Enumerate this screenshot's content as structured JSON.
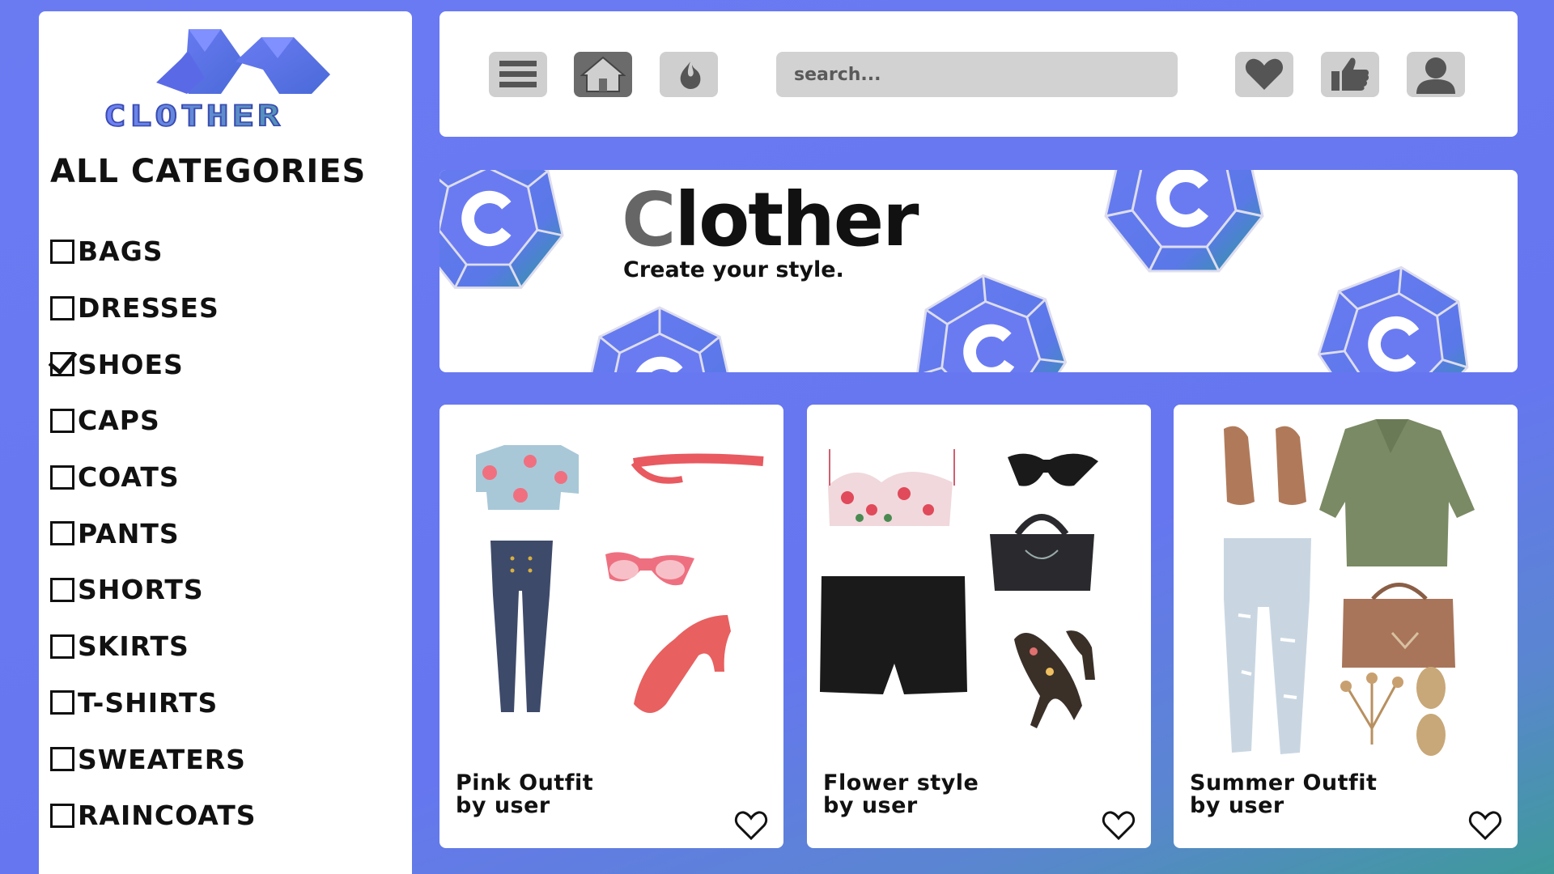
{
  "brand": {
    "logo_text": "CLOTHER",
    "banner_title": "Clother",
    "banner_tagline": "Create your style."
  },
  "sidebar": {
    "title": "ALL CATEGORIES",
    "categories": [
      {
        "label": "BAGS",
        "checked": false
      },
      {
        "label": "DRESSES",
        "checked": false
      },
      {
        "label": "SHOES",
        "checked": true
      },
      {
        "label": "CAPS",
        "checked": false
      },
      {
        "label": "COATS",
        "checked": false
      },
      {
        "label": "PANTS",
        "checked": false
      },
      {
        "label": "SHORTS",
        "checked": false
      },
      {
        "label": "SKIRTS",
        "checked": false
      },
      {
        "label": "T-SHIRTS",
        "checked": false
      },
      {
        "label": "SWEATERS",
        "checked": false
      },
      {
        "label": "RAINCOATS",
        "checked": false
      }
    ]
  },
  "toolbar": {
    "left_icons": [
      "menu-icon",
      "home-icon",
      "flame-icon"
    ],
    "search_placeholder": "search...",
    "right_icons": [
      "heart-icon",
      "thumbs-up-icon",
      "user-icon"
    ]
  },
  "outfits": [
    {
      "title": "Pink Outfit",
      "author": "by user"
    },
    {
      "title": "Flower style",
      "author": "by user"
    },
    {
      "title": "Summer Outfit",
      "author": "by user"
    }
  ],
  "colors": {
    "accent": "#6a7bf2",
    "teal": "#3e9a9a",
    "button_gray": "#cfcfcf",
    "button_dark": "#6b6b6b"
  }
}
